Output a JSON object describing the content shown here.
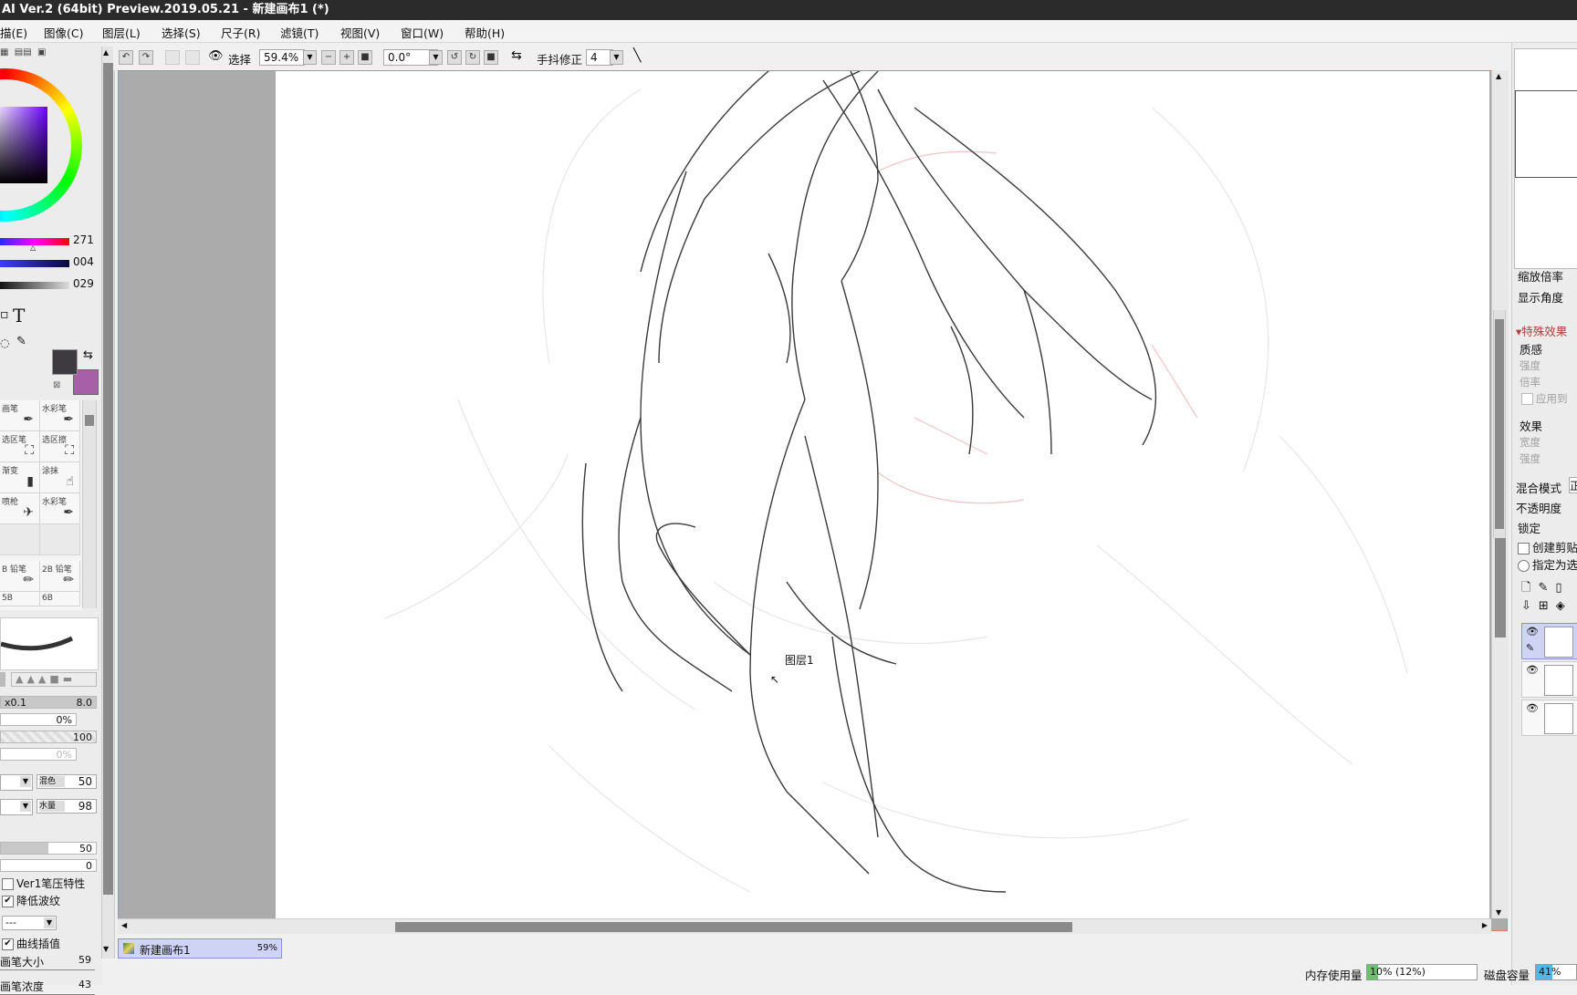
{
  "window": {
    "title": "AI Ver.2 (64bit) Preview.2019.05.21 - 新建画布1 (*)"
  },
  "menu": {
    "items": [
      "描(E)",
      "图像(C)",
      "图层(L)",
      "选择(S)",
      "尺子(R)",
      "滤镜(T)",
      "视图(V)",
      "窗口(W)",
      "帮助(H)"
    ]
  },
  "toolbar": {
    "select_label": "选择",
    "zoom": "59.4%",
    "rotation": "0.0°",
    "stabilizer_label": "手抖修正",
    "stabilizer_value": "4"
  },
  "color_panel": {
    "sliders": [
      {
        "value": "271"
      },
      {
        "value": "004"
      },
      {
        "value": "029"
      }
    ],
    "fg_color": "#3d3b40",
    "bg_color": "#a760a8",
    "text_tool": "T"
  },
  "tools": {
    "cells": [
      {
        "label": "画笔",
        "icon": "brush-icon"
      },
      {
        "label": "水彩笔",
        "icon": "watercolor-icon"
      },
      {
        "label": "选区笔",
        "icon": "selection-pen-icon"
      },
      {
        "label": "选区擦",
        "icon": "selection-eraser-icon"
      },
      {
        "label": "渐变",
        "icon": "gradient-icon"
      },
      {
        "label": "涂抹",
        "icon": "smudge-icon"
      },
      {
        "label": "喷枪",
        "icon": "airbrush-icon"
      },
      {
        "label": "水彩笔",
        "icon": "watercolor-icon"
      }
    ],
    "pencils": [
      {
        "label": "B 铅笔"
      },
      {
        "label": "2B 铅笔"
      },
      {
        "label": "5B"
      },
      {
        "label": "6B"
      }
    ]
  },
  "brush_settings": {
    "size_multiplier": "x0.1",
    "size_value": "8.0",
    "min_size": "0%",
    "density": "100",
    "min_density": "0%",
    "blend_label": "混色",
    "blend_value": "50",
    "water_label": "水量",
    "water_value": "98",
    "persist_value": "50",
    "zero_value": "0",
    "ver1_pressure": "Ver1笔压特性",
    "reduce_ripple": "降低波纹",
    "dash_option": "---",
    "curve_interp": "曲线插值",
    "pen_size_label": "画笔大小",
    "pen_size_value": "59",
    "pen_density_label": "画笔浓度",
    "pen_density_value": "43"
  },
  "canvas": {
    "tooltip": "图层1",
    "tab_name": "新建画布1",
    "tab_zoom": "59%"
  },
  "right_panel": {
    "zoom_label": "缩放倍率",
    "angle_label": "显示角度",
    "effects_header": "特殊效果",
    "texture_label": "质感",
    "strength_label": "强度",
    "scale_label": "倍率",
    "apply_label": "应用到",
    "effect_label": "效果",
    "width_label": "宽度",
    "strength2_label": "强度",
    "blend_mode_label": "混合模式",
    "blend_mode_value": "正",
    "opacity_label": "不透明度",
    "lock_label": "锁定",
    "clip_label": "创建剪贴",
    "select_source_label": "指定为选"
  },
  "status": {
    "memory_label": "内存使用量",
    "memory_value": "10% (12%)",
    "memory_fraction": 0.1,
    "disk_label": "磁盘容量",
    "disk_value": "41%",
    "disk_fraction": 0.41
  }
}
